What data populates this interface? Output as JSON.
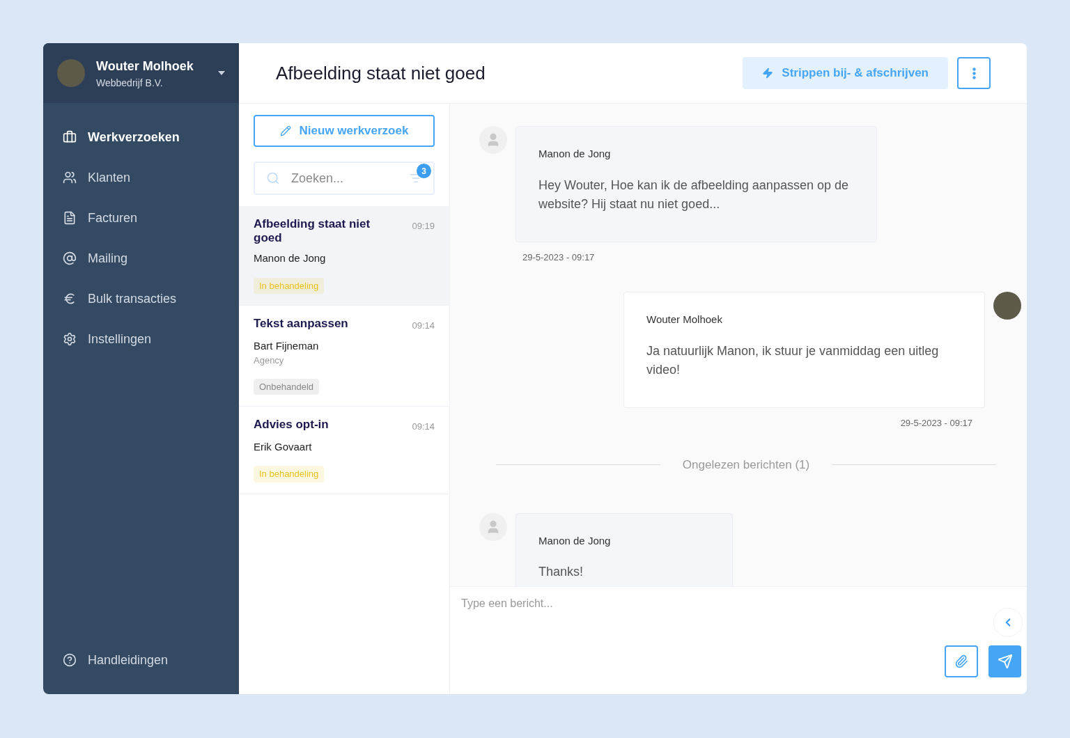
{
  "user": {
    "name": "Wouter Molhoek",
    "company": "Webbedrijf B.V."
  },
  "nav": [
    {
      "label": "Werkverzoeken",
      "selected": true
    },
    {
      "label": "Klanten",
      "selected": false
    },
    {
      "label": "Facturen",
      "selected": false
    },
    {
      "label": "Mailing",
      "selected": false
    },
    {
      "label": "Bulk transacties",
      "selected": false
    },
    {
      "label": "Instellingen",
      "selected": false
    }
  ],
  "help": {
    "label": "Handleidingen"
  },
  "header": {
    "title": "Afbeelding staat niet goed",
    "action": "Strippen bij- & afschrijven"
  },
  "new_button": "Nieuw werkverzoek",
  "search": {
    "placeholder": "Zoeken...",
    "filter_count": "3"
  },
  "requests": [
    {
      "title": "Afbeelding staat niet goed",
      "time": "09:19",
      "customer": "Manon de Jong",
      "status": "In behandeling",
      "color": "#e8c21c",
      "selected": true
    },
    {
      "title": "Tekst aanpassen",
      "time": "09:14",
      "customer": "Bart Fijneman",
      "company": "Agency",
      "status": "Onbehandeld",
      "color": "#888888",
      "selected": false
    },
    {
      "title": "Advies opt-in",
      "time": "09:14",
      "customer": "Erik Govaart",
      "status": "In behandeling",
      "color": "#e8c21c",
      "selected": false
    }
  ],
  "messages": [
    {
      "kind": "incoming",
      "author": "Manon de Jong",
      "text": "Hey Wouter, Hoe kan ik de afbeelding aanpassen op de website? Hij staat nu niet goed...",
      "date": "29-5-2023 - 09:17"
    },
    {
      "kind": "outgoing",
      "author": "Wouter Molhoek",
      "text": "Ja natuurlijk Manon, ik stuur je vanmiddag een uitleg video!",
      "date": "29-5-2023 - 09:17"
    },
    {
      "kind": "divider",
      "text": "Ongelezen berichten (1)"
    },
    {
      "kind": "incoming",
      "author": "Manon de Jong",
      "text": "Thanks!"
    }
  ],
  "composer": {
    "placeholder": "Type een bericht..."
  }
}
